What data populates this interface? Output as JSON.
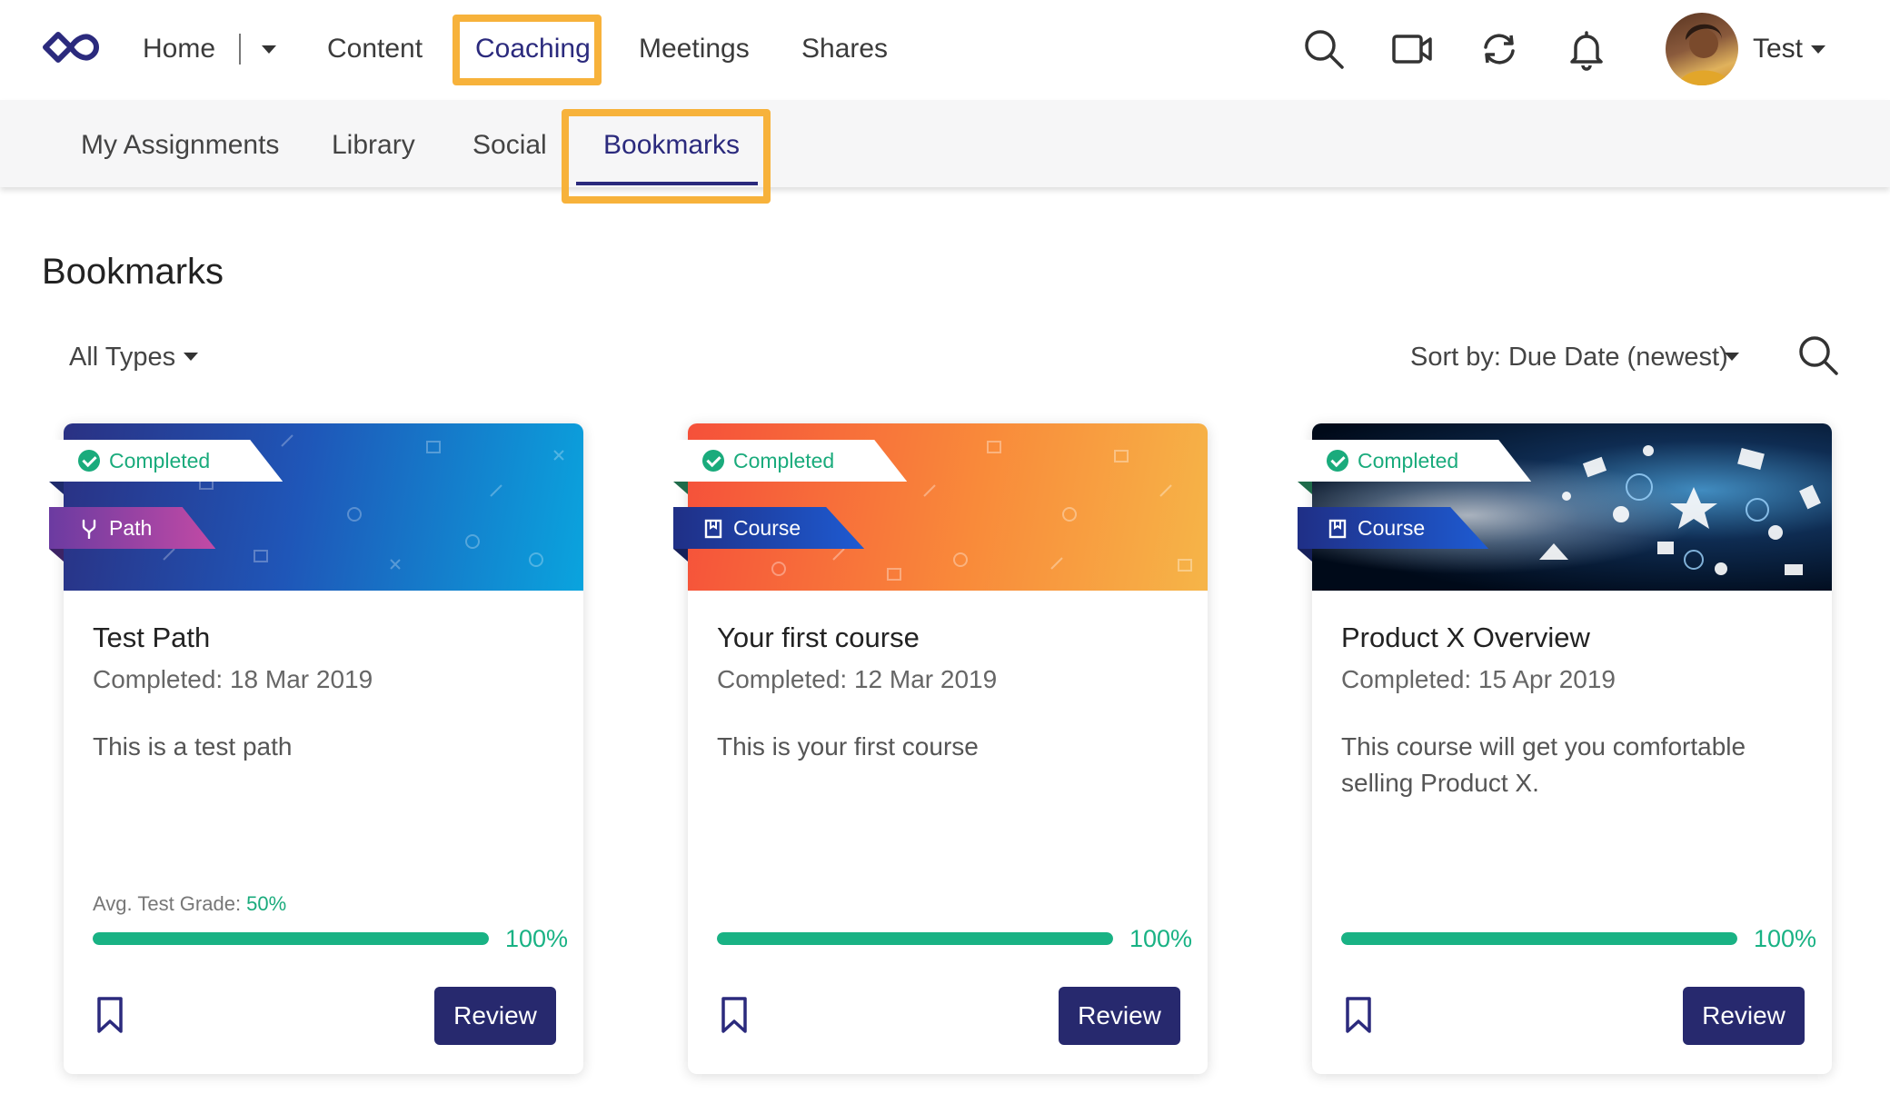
{
  "topnav": {
    "items": [
      {
        "label": "Home"
      },
      {
        "label": "Content"
      },
      {
        "label": "Coaching"
      },
      {
        "label": "Meetings"
      },
      {
        "label": "Shares"
      }
    ],
    "active": "Coaching",
    "user": {
      "name": "Test"
    },
    "icons": [
      "logo-icon",
      "search-icon",
      "video-icon",
      "sync-icon",
      "bell-icon"
    ]
  },
  "subnav": {
    "items": [
      {
        "label": "My Assignments"
      },
      {
        "label": "Library"
      },
      {
        "label": "Social"
      },
      {
        "label": "Bookmarks"
      }
    ],
    "active": "Bookmarks"
  },
  "page": {
    "title": "Bookmarks",
    "filter_label": "All Types",
    "sort_label": "Sort by: Due Date (newest)"
  },
  "cards": [
    {
      "status": "Completed",
      "type": "Path",
      "title": "Test Path",
      "date": "Completed: 18 Mar 2019",
      "description": "This is a test path",
      "avg_label": "Avg. Test Grade: ",
      "avg_value": "50%",
      "progress": 1.0,
      "progress_label": "100%",
      "button": "Review"
    },
    {
      "status": "Completed",
      "type": "Course",
      "title": "Your first course",
      "date": "Completed: 12 Mar 2019",
      "description": "This is your first course",
      "progress": 1.0,
      "progress_label": "100%",
      "button": "Review"
    },
    {
      "status": "Completed",
      "type": "Course",
      "title": "Product X Overview",
      "date": "Completed: 15 Apr 2019",
      "description": "This course will get you comfortable selling Product X.",
      "progress": 1.0,
      "progress_label": "100%",
      "button": "Review"
    }
  ],
  "colors": {
    "brand": "#2b2a7d",
    "highlight": "#f7b23b",
    "success": "#19b284",
    "button": "#27296e"
  }
}
